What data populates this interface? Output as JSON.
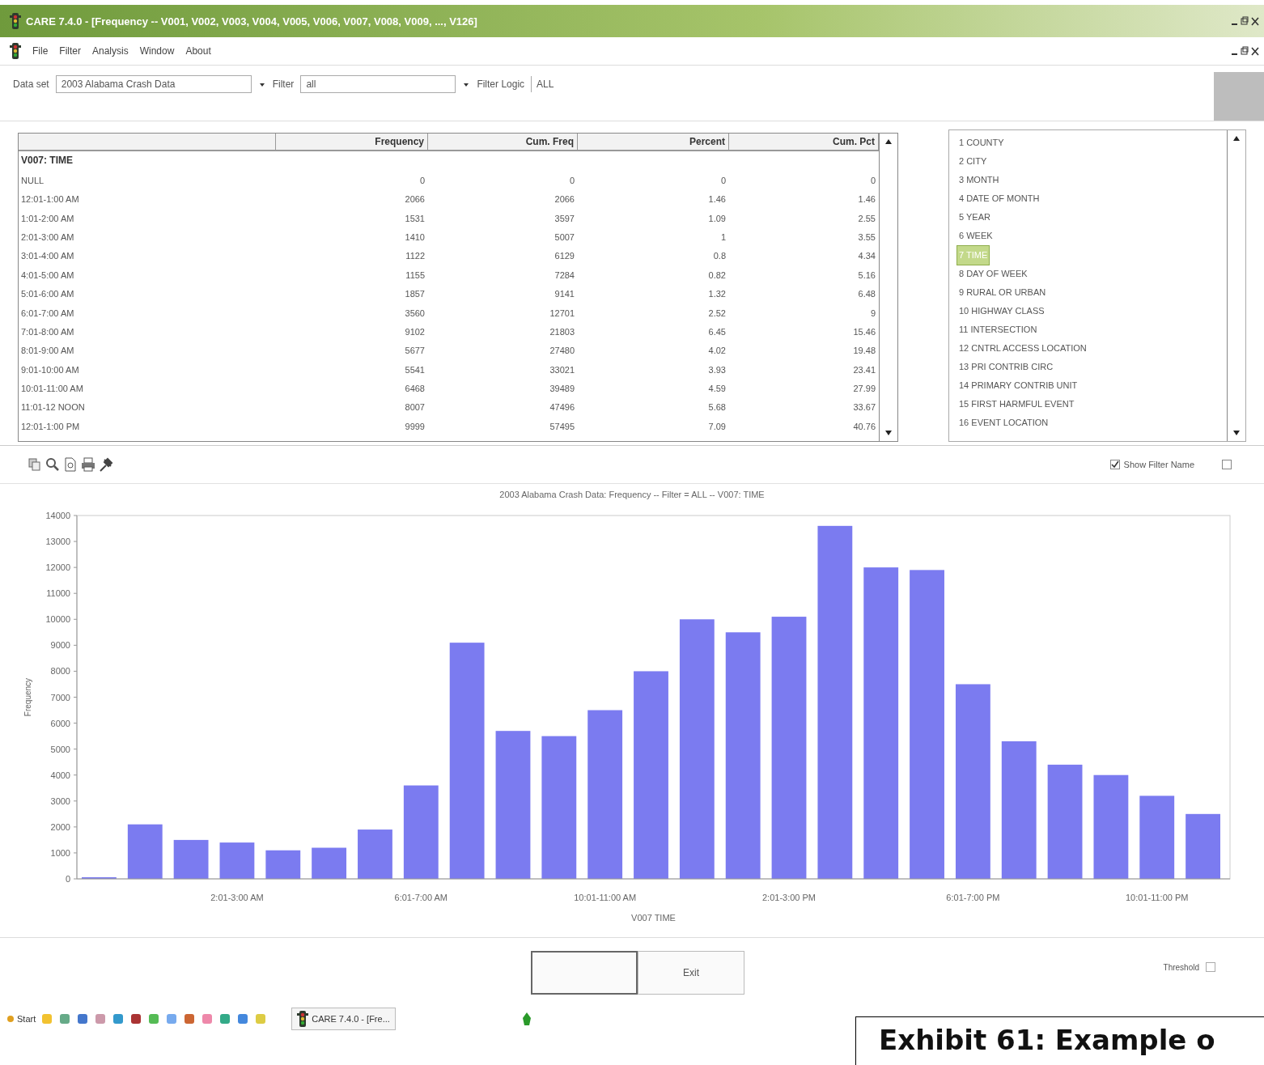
{
  "window": {
    "title": "CARE 7.4.0 - [Frequency -- V001, V002, V003, V004, V005, V006, V007, V008, V009, ..., V126]"
  },
  "menu": [
    "File",
    "Filter",
    "Analysis",
    "Window",
    "About"
  ],
  "toolbar": {
    "dataset_label": "Data set",
    "dataset_value": "2003 Alabama Crash Data",
    "filter_label": "Filter",
    "filter_value": "all",
    "logic_label": "Filter Logic",
    "logic_value": "ALL"
  },
  "table": {
    "columns": [
      "",
      "Frequency",
      "Cum. Freq",
      "Percent",
      "Cum. Pct"
    ],
    "group": "V007: TIME",
    "rows": [
      [
        "NULL",
        "0",
        "0",
        "0",
        "0"
      ],
      [
        "12:01-1:00 AM",
        "2066",
        "2066",
        "1.46",
        "1.46"
      ],
      [
        "1:01-2:00 AM",
        "1531",
        "3597",
        "1.09",
        "2.55"
      ],
      [
        "2:01-3:00 AM",
        "1410",
        "5007",
        "1",
        "3.55"
      ],
      [
        "3:01-4:00 AM",
        "1122",
        "6129",
        "0.8",
        "4.34"
      ],
      [
        "4:01-5:00 AM",
        "1155",
        "7284",
        "0.82",
        "5.16"
      ],
      [
        "5:01-6:00 AM",
        "1857",
        "9141",
        "1.32",
        "6.48"
      ],
      [
        "6:01-7:00 AM",
        "3560",
        "12701",
        "2.52",
        "9"
      ],
      [
        "7:01-8:00 AM",
        "9102",
        "21803",
        "6.45",
        "15.46"
      ],
      [
        "8:01-9:00 AM",
        "5677",
        "27480",
        "4.02",
        "19.48"
      ],
      [
        "9:01-10:00 AM",
        "5541",
        "33021",
        "3.93",
        "23.41"
      ],
      [
        "10:01-11:00 AM",
        "6468",
        "39489",
        "4.59",
        "27.99"
      ],
      [
        "11:01-12 NOON",
        "8007",
        "47496",
        "5.68",
        "33.67"
      ],
      [
        "12:01-1:00 PM",
        "9999",
        "57495",
        "7.09",
        "40.76"
      ]
    ]
  },
  "variables": [
    {
      "label": "1 COUNTY",
      "selected": false
    },
    {
      "label": "2 CITY",
      "selected": false
    },
    {
      "label": "3 MONTH",
      "selected": false
    },
    {
      "label": "4 DATE OF MONTH",
      "selected": false
    },
    {
      "label": "5 YEAR",
      "selected": false
    },
    {
      "label": "6 WEEK",
      "selected": false
    },
    {
      "label": "7 TIME",
      "selected": true
    },
    {
      "label": "8 DAY OF WEEK",
      "selected": false
    },
    {
      "label": "9 RURAL OR URBAN",
      "selected": false
    },
    {
      "label": "10 HIGHWAY CLASS",
      "selected": false
    },
    {
      "label": "11 INTERSECTION",
      "selected": false
    },
    {
      "label": "12 CNTRL ACCESS LOCATION",
      "selected": false
    },
    {
      "label": "13 PRI CONTRIB CIRC",
      "selected": false
    },
    {
      "label": "14 PRIMARY CONTRIB UNIT",
      "selected": false
    },
    {
      "label": "15 FIRST HARMFUL EVENT",
      "selected": false
    },
    {
      "label": "16 EVENT LOCATION",
      "selected": false
    }
  ],
  "chart_options": [
    {
      "label": "Show Filter Name",
      "checked": true
    },
    {
      "checked": false
    }
  ],
  "chart": {
    "chart_data": {
      "type": "bar",
      "title": "2003 Alabama Crash Data: Frequency -- Filter = ALL -- V007: TIME",
      "xlabel": "V007 TIME",
      "ylabel": "Frequency",
      "categories": [
        null,
        null,
        null,
        "2:01-3:00 AM",
        null,
        null,
        null,
        "6:01-7:00 AM",
        null,
        null,
        null,
        "10:01-11:00 AM",
        null,
        null,
        null,
        "2:01-3:00 PM",
        null,
        null,
        null,
        "6:01-7:00 PM",
        null,
        null,
        null,
        "10:01-11:00 PM",
        null
      ],
      "series": [
        {
          "color": "#7b7bf0",
          "values": [
            0,
            2100,
            1500,
            1400,
            1100,
            1200,
            1900,
            3600,
            9100,
            5700,
            5500,
            6500,
            8000,
            10000,
            9500,
            10100,
            13600,
            12000,
            11900,
            7500,
            5300,
            4400,
            4000,
            3200,
            2500
          ]
        }
      ],
      "ylim": [
        0,
        14000
      ],
      "yticks": [
        0,
        1000,
        2000,
        3000,
        4000,
        5000,
        6000,
        7000,
        8000,
        9000,
        10000,
        11000,
        12000,
        13000,
        14000
      ]
    }
  },
  "buttons": [
    {
      "default": true
    },
    {
      "label": "Exit",
      "default": false
    }
  ],
  "threshold": {
    "label": "Threshold",
    "checked": false
  },
  "taskbar": {
    "start": "Start",
    "task": "CARE 7.4.0 - [Fre..."
  },
  "caption": "Exhibit 61: Example o"
}
